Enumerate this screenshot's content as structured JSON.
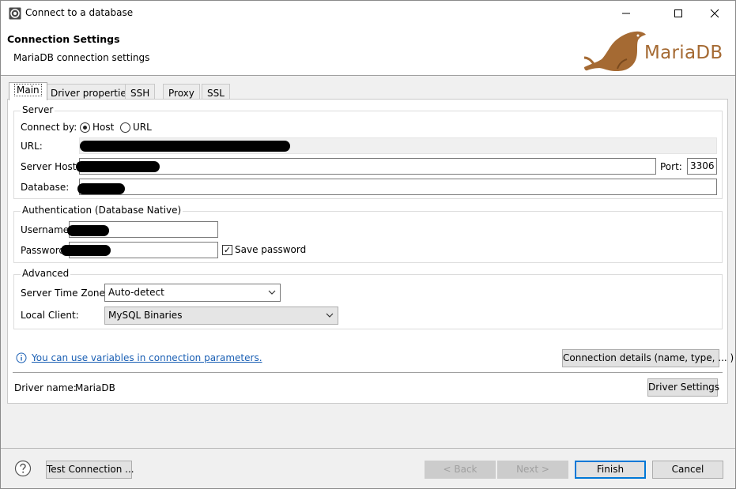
{
  "window": {
    "title": "Connect to a database"
  },
  "header": {
    "title": "Connection Settings",
    "subtitle": "MariaDB connection settings",
    "logo_text": "MariaDB"
  },
  "tabs": [
    {
      "label": "Main",
      "active": true
    },
    {
      "label": "Driver properties"
    },
    {
      "label": "SSH"
    },
    {
      "label": "Proxy"
    },
    {
      "label": "SSL"
    }
  ],
  "server": {
    "title": "Server",
    "connect_by_label": "Connect by:",
    "host_option": "Host",
    "url_option": "URL",
    "selected": "Host",
    "url_label": "URL:",
    "host_label": "Server Host:",
    "port_label": "Port:",
    "port_value": "3306",
    "database_label": "Database:"
  },
  "auth": {
    "title": "Authentication (Database Native)",
    "username_label": "Username:",
    "password_label": "Password:",
    "save_password_label": "Save password",
    "save_password_checked": true
  },
  "advanced": {
    "title": "Advanced",
    "timezone_label": "Server Time Zone:",
    "timezone_value": "Auto-detect",
    "local_client_label": "Local Client:",
    "local_client_value": "MySQL Binaries"
  },
  "info_link": "You can use variables in connection parameters.",
  "connection_details_button": "Connection details (name, type, ... )",
  "driver": {
    "label": "Driver name:",
    "value": "MariaDB",
    "settings_button": "Driver Settings"
  },
  "footer": {
    "test_connection": "Test Connection ...",
    "back": "< Back",
    "next": "Next >",
    "finish": "Finish",
    "cancel": "Cancel"
  },
  "colors": {
    "accent": "#0078d7",
    "link": "#1a5fb4",
    "logo": "#a56a33"
  }
}
